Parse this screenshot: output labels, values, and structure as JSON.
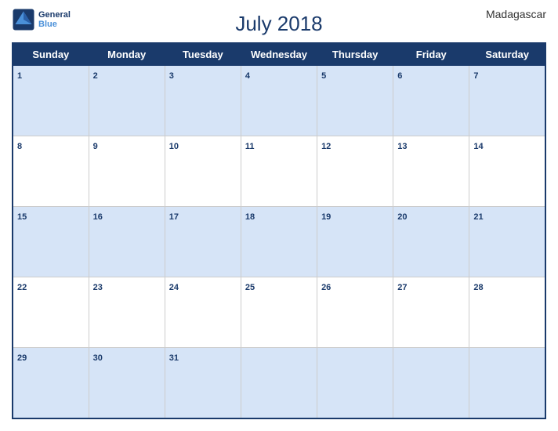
{
  "header": {
    "title": "July 2018",
    "country": "Madagascar",
    "logo_line1": "General",
    "logo_line2": "Blue"
  },
  "days": [
    "Sunday",
    "Monday",
    "Tuesday",
    "Wednesday",
    "Thursday",
    "Friday",
    "Saturday"
  ],
  "weeks": [
    [
      1,
      2,
      3,
      4,
      5,
      6,
      7
    ],
    [
      8,
      9,
      10,
      11,
      12,
      13,
      14
    ],
    [
      15,
      16,
      17,
      18,
      19,
      20,
      21
    ],
    [
      22,
      23,
      24,
      25,
      26,
      27,
      28
    ],
    [
      29,
      30,
      31,
      null,
      null,
      null,
      null
    ]
  ]
}
